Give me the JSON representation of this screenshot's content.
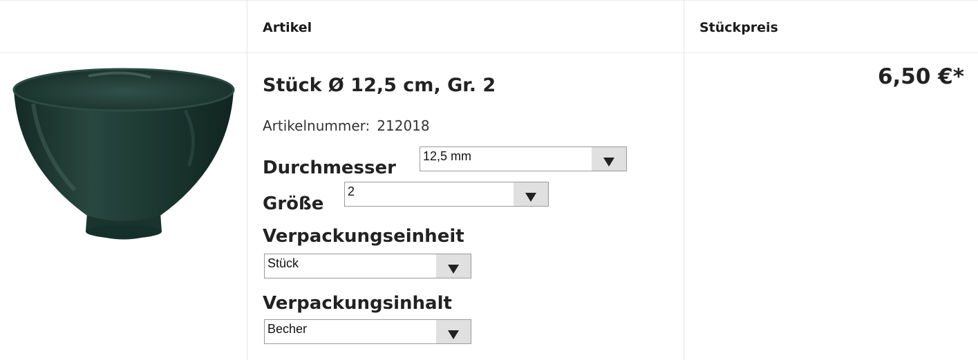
{
  "header": {
    "col_article": "Artikel",
    "col_unit_price": "Stückpreis"
  },
  "product": {
    "title": "Stück Ø 12,5 cm, Gr. 2",
    "article_number_label": "Artikelnummer:",
    "article_number": "212018",
    "image_icon": "green-rubber-bowl-image",
    "price": "6,50 €*"
  },
  "options": {
    "diameter": {
      "label": "Durchmesser",
      "value": "12,5 mm"
    },
    "size": {
      "label": "Größe",
      "value": "2"
    },
    "packaging_unit": {
      "label": "Verpackungseinheit",
      "value": "Stück"
    },
    "packaging_content": {
      "label": "Verpackungsinhalt",
      "value": "Becher"
    }
  },
  "colors": {
    "bowl": "#1f3a33",
    "select_button": "#e0e0e0",
    "border": "#e6e6e6"
  }
}
